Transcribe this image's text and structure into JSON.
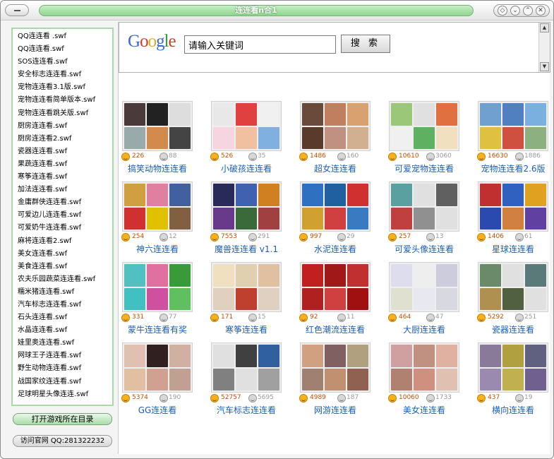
{
  "window": {
    "title": "连连看n合1"
  },
  "sidebar": {
    "files": [
      "QQ连连看 .swf",
      "QQ连连看.swf",
      "SOS连连看.swf",
      "安全标志连连看.swf",
      "宠物连连看3.1版.swf",
      "宠物连连看简单版本.swf",
      "宠物连连看跳关版.swf",
      "厨房连连看.swf",
      "厨房连连看2.swf",
      "瓷器连连看.swf",
      "果蔬连连看.swf",
      "寒筝连连看.swf",
      "加法连连看.swf",
      "金庸群侠连连看.swf",
      "可爱边儿连连看.swf",
      "可爱奶牛连连看.swf",
      "麻将连连看2.swf",
      "美女连连看.swf",
      "美食连连看.swf",
      "农夫乐园蔬菜连连看.swf",
      "糯米猪连连看.swf",
      "汽车标志连连看.swf",
      "石头连连看.swf",
      "水晶连连看.swf",
      "娃里奥连连看.swf",
      "网球王子连连看.swf",
      "野生动物连连看.swf",
      "战国家纹连连看.swf",
      "足球明星头像连连.swf"
    ],
    "open_dir_label": "打开游戏所在目录",
    "visit_site_label": "访问官网 QQ:281322232"
  },
  "search": {
    "logo": "Google",
    "input_value": "请输入关键词",
    "button_label": "搜 索"
  },
  "games": [
    {
      "name": "搞笑动物连连看",
      "likes": "226",
      "dislikes": "88",
      "colors": [
        "#4a3a3a",
        "#222",
        "#ddd",
        "#9aa",
        "#d28b4c",
        "#444"
      ]
    },
    {
      "name": "小破孩连连看",
      "likes": "526",
      "dislikes": "35",
      "colors": [
        "#e8e8e8",
        "#e04040",
        "#f0f0f0",
        "#f7d5e0",
        "#f0c0a0",
        "#80b0e0"
      ]
    },
    {
      "name": "超女连连看",
      "likes": "1486",
      "dislikes": "160",
      "colors": [
        "#6a4a3a",
        "#c08060",
        "#d9a070",
        "#5a3a2a",
        "#c09080",
        "#d0b090"
      ]
    },
    {
      "name": "可爱宠物连连看",
      "likes": "10610",
      "dislikes": "3060",
      "colors": [
        "#9bc878",
        "#e0e0e0",
        "#e07040",
        "#f0f0f0",
        "#5fb060",
        "#f0e0c0"
      ]
    },
    {
      "name": "宠物连连看2.6版",
      "likes": "16630",
      "dislikes": "1886",
      "colors": [
        "#6fa0d0",
        "#5080c0",
        "#7ab0e0",
        "#e0c040",
        "#d05040",
        "#8cb080"
      ]
    },
    {
      "name": "神六连连看",
      "likes": "254",
      "dislikes": "12",
      "colors": [
        "#d0a040",
        "#e080a0",
        "#4060a0",
        "#d03030",
        "#e0c000",
        "#806040"
      ]
    },
    {
      "name": "魔兽连连看 v1.1",
      "likes": "7553",
      "dislikes": "291",
      "colors": [
        "#2a2a5a",
        "#4060b0",
        "#d08020",
        "#6a3a8a",
        "#3a6a3a",
        "#a04040"
      ]
    },
    {
      "name": "水泥连连看",
      "likes": "997",
      "dislikes": "29",
      "colors": [
        "#3070c0",
        "#2060a0",
        "#d03030",
        "#d0a030",
        "#d04040",
        "#3a7ac0"
      ]
    },
    {
      "name": "可爱头像连连看",
      "likes": "257",
      "dislikes": "13",
      "colors": [
        "#5aa0a0",
        "#e0e0e0",
        "#606060",
        "#c04040",
        "#909090",
        "#e0e0e0"
      ]
    },
    {
      "name": "星球连连看",
      "likes": "1406",
      "dislikes": "61",
      "colors": [
        "#c03030",
        "#3060c0",
        "#e0a020",
        "#2a4ab0",
        "#d08040",
        "#6040a0"
      ]
    },
    {
      "name": "蒙牛连连看有奖",
      "likes": "331",
      "dislikes": "77",
      "colors": [
        "#50c0c0",
        "#e070a0",
        "#3a9a3a",
        "#40c0c0",
        "#d050a0",
        "#60c060"
      ]
    },
    {
      "name": "寒筝连连看",
      "likes": "171",
      "dislikes": "15",
      "colors": [
        "#f0e0c0",
        "#e0d0b0",
        "#e0c0a0",
        "#e0d0c0",
        "#c04030",
        "#e0d0c0"
      ]
    },
    {
      "name": "红色潮流连连看",
      "likes": "92",
      "dislikes": "11",
      "colors": [
        "#c02020",
        "#a01818",
        "#c03030",
        "#b02020",
        "#d04040",
        "#a01010"
      ]
    },
    {
      "name": "大厨连连看",
      "likes": "464",
      "dislikes": "47",
      "colors": [
        "#dde",
        "#eee",
        "#ccd",
        "#e0e0d0",
        "#e8e8f0",
        "#d8d8e0"
      ]
    },
    {
      "name": "瓷器连连看",
      "likes": "5292",
      "dislikes": "251",
      "colors": [
        "#6a8a6a",
        "#e0e0e0",
        "#5a7a7a",
        "#b09050",
        "#506040",
        "#e0e0e0"
      ]
    },
    {
      "name": "GG连连看",
      "likes": "5374",
      "dislikes": "190",
      "colors": [
        "#e0c0b0",
        "#302020",
        "#d0b0a0",
        "#e0c0a0",
        "#d0a090",
        "#c0a090"
      ]
    },
    {
      "name": "汽车标志连连看",
      "likes": "52757",
      "dislikes": "5695",
      "colors": [
        "#e0e0e0",
        "#404040",
        "#3060a0",
        "#808080",
        "#e0e0e0",
        "#a0a0a0"
      ]
    },
    {
      "name": "网游连连看",
      "likes": "4989",
      "dislikes": "187",
      "colors": [
        "#d0a080",
        "#806060",
        "#b0a080",
        "#a08070",
        "#c09070",
        "#906050"
      ]
    },
    {
      "name": "美女连连看",
      "likes": "10060",
      "dislikes": "1733",
      "colors": [
        "#d0a0a0",
        "#c09080",
        "#e0b0a0",
        "#b08070",
        "#d09080",
        "#e0c0b0"
      ]
    },
    {
      "name": "横向连连看",
      "likes": "437",
      "dislikes": "19",
      "colors": [
        "#8a7a9a",
        "#b0a040",
        "#606080",
        "#9a8ab0",
        "#c0b050",
        "#706090"
      ]
    }
  ]
}
